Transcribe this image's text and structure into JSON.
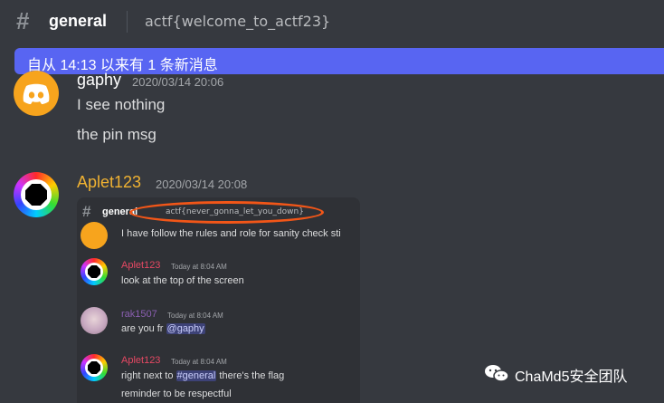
{
  "header": {
    "channel": "general",
    "topic": "actf{welcome_to_actf23}"
  },
  "new_messages_bar": "自从 14:13 以来有 1 条新消息",
  "messages": [
    {
      "author": "gaphy",
      "timestamp": "2020/03/14 20:06",
      "lines": [
        "I see nothing",
        "the pin msg"
      ]
    },
    {
      "author": "Aplet123",
      "timestamp": "2020/03/14 20:08"
    }
  ],
  "embed": {
    "channel": "general",
    "topic": "actf{never_gonna_let_you_down}",
    "first_line": "I have follow the rules and role for sanity check sti",
    "msgs": [
      {
        "author": "Aplet123",
        "time": "Today at 8:04 AM",
        "text": "look at the top of the screen"
      },
      {
        "author": "rak1507",
        "time": "Today at 8:04 AM",
        "text_prefix": "are you fr ",
        "mention": "@gaphy"
      },
      {
        "author": "Aplet123",
        "time": "Today at 8:04 AM",
        "text_prefix": "right next to ",
        "mention": "#general",
        "text_suffix": " there's the flag",
        "line2": "reminder to be respectful"
      }
    ]
  },
  "watermark": "ChaMd5安全团队",
  "colors": {
    "accent": "#5865f2",
    "aplet_name": "#f0b232",
    "embed_aplet": "#e54863",
    "rak": "#8a5fb0",
    "circle": "#f25618"
  }
}
